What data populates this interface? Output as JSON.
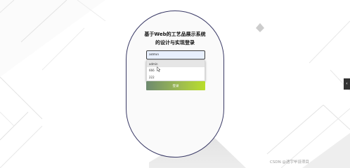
{
  "login": {
    "title_line1": "基于Web的工艺品展示系统",
    "title_line2": "的设计与实现登录",
    "username_value": "admin",
    "login_button": "登录"
  },
  "autocomplete": {
    "options": [
      "admin",
      "666",
      "222"
    ],
    "selected_index": 0
  },
  "side_tab": {
    "icon": "chevron-left-icon",
    "glyph": "‹"
  },
  "watermark": "CSDN @遇宇毕设项目"
}
